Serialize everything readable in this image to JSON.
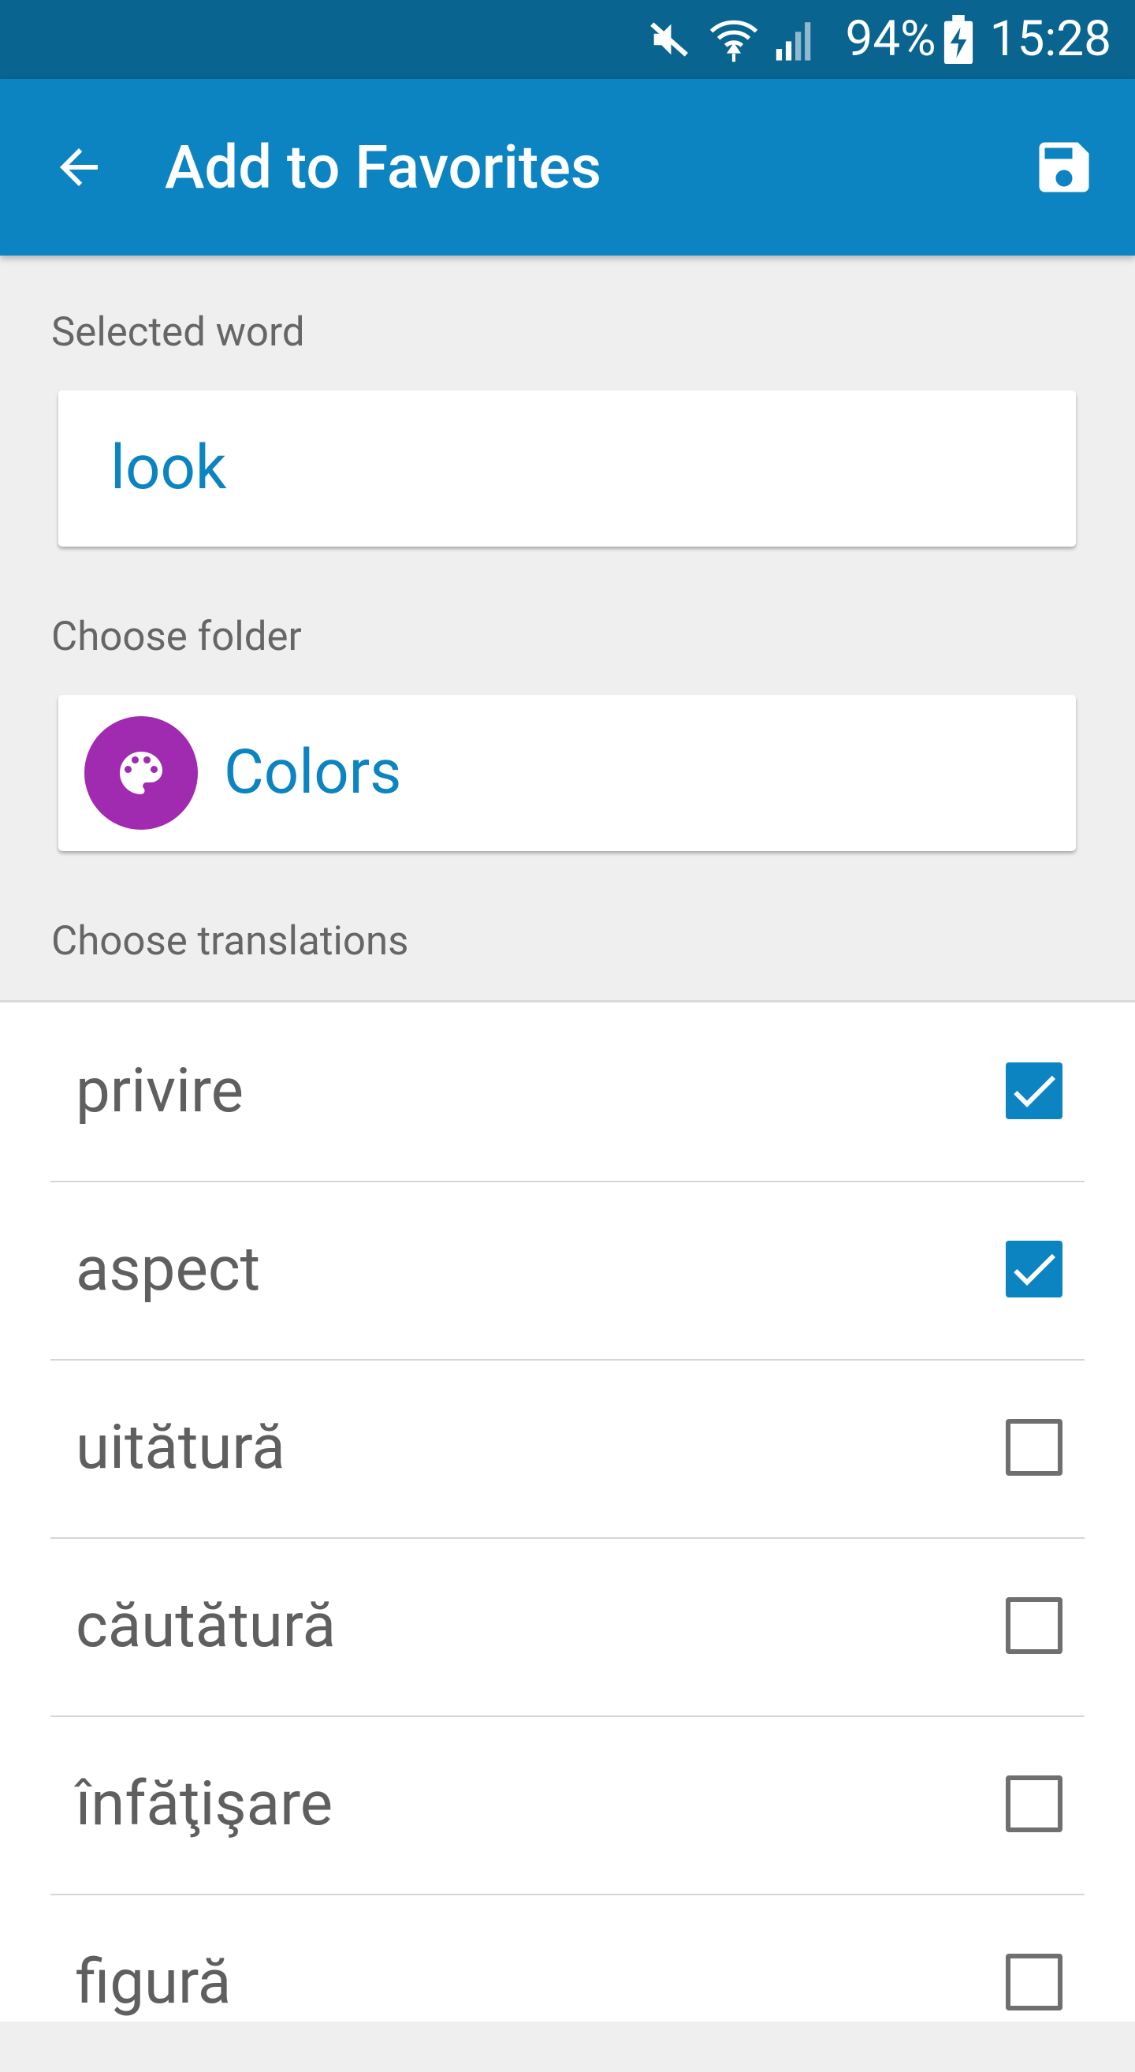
{
  "status_bar": {
    "battery": "94%",
    "time": "15:28",
    "icons": [
      "mute-icon",
      "wifi-icon",
      "signal-icon",
      "battery-charging-icon"
    ]
  },
  "app_bar": {
    "title": "Add to Favorites",
    "back_icon": "arrow-back-icon",
    "save_icon": "save-icon"
  },
  "selected_word": {
    "label": "Selected word",
    "value": "look"
  },
  "folder": {
    "label": "Choose folder",
    "name": "Colors",
    "icon": "palette-icon",
    "avatar_color": "#a02bb0"
  },
  "translations": {
    "label": "Choose translations",
    "items": [
      {
        "text": "privire",
        "checked": true
      },
      {
        "text": "aspect",
        "checked": true
      },
      {
        "text": "uitătură",
        "checked": false
      },
      {
        "text": "căutătură",
        "checked": false
      },
      {
        "text": "înfăţişare",
        "checked": false
      },
      {
        "text": "figură",
        "checked": false
      }
    ]
  },
  "colors": {
    "status_bar": "#0a6490",
    "app_bar": "#0b84c1",
    "accent": "#0b84c1"
  }
}
